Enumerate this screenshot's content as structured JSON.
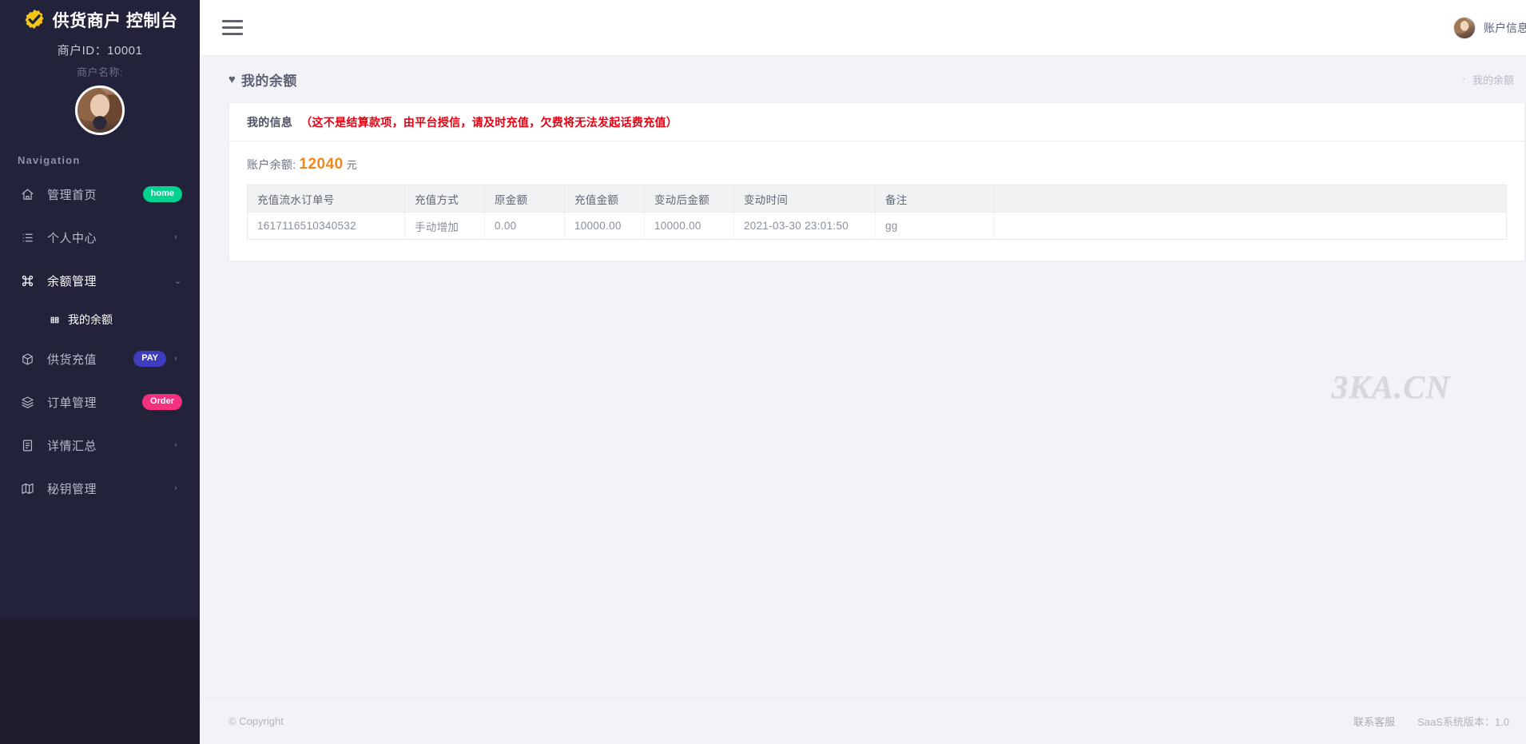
{
  "sidebar": {
    "brand_title": "供货商户 控制台",
    "brand_logo_icon": "gear-check-icon",
    "merchant_id": "商户ID：10001",
    "merchant_name": "商户名称:",
    "avatar_icon": "user-avatar",
    "nav_section_title": "Navigation",
    "items": [
      {
        "label": "管理首页",
        "icon": "home-icon",
        "badge": "home",
        "badge_color": "#00d28f",
        "arrow": "",
        "active": false
      },
      {
        "label": "个人中心",
        "icon": "list-icon",
        "badge": "",
        "badge_color": "",
        "arrow": "›",
        "active": false
      },
      {
        "label": "余额管理",
        "icon": "command-icon",
        "badge": "",
        "badge_color": "",
        "arrow": "⌄",
        "active": true
      },
      {
        "label": "供货充值",
        "icon": "box-icon",
        "badge": "PAY",
        "badge_color": "#4b4bd6",
        "arrow": "›",
        "active": false
      },
      {
        "label": "订单管理",
        "icon": "layers-icon",
        "badge": "Order",
        "badge_color": "#f5317f",
        "arrow": "",
        "active": false
      },
      {
        "label": "详情汇总",
        "icon": "file-icon",
        "badge": "",
        "badge_color": "",
        "arrow": "›",
        "active": false
      },
      {
        "label": "秘钥管理",
        "icon": "map-icon",
        "badge": "",
        "badge_color": "",
        "arrow": "›",
        "active": false
      }
    ],
    "sub_item": {
      "label": "我的余额",
      "icon": "balance-icon"
    }
  },
  "topbar": {
    "menu_toggle_icon": "hamburger-icon",
    "account_label": "账户信息",
    "account_avatar_icon": "user-avatar"
  },
  "page": {
    "title": "我的余额",
    "title_icon": "heart-icon",
    "breadcrumb_sep": "›",
    "breadcrumb_current": "我的余额"
  },
  "card": {
    "head_title": "我的信息",
    "head_warning": "（这不是结算款项，由平台授信，请及时充值，欠费将无法发起话费充值）",
    "warning_color": "#e60012",
    "balance_label": "账户余额:",
    "balance_amount": "12040",
    "balance_unit": "元",
    "balance_color": "#f0861e"
  },
  "table": {
    "columns": [
      "充值流水订单号",
      "充值方式",
      "原金额",
      "充值金额",
      "变动后金额",
      "变动时间",
      "备注",
      ""
    ],
    "rows": [
      {
        "order_no": "1617116510340532",
        "method": "手动增加",
        "original_amount": "0.00",
        "recharge_amount": "10000.00",
        "after_amount": "10000.00",
        "change_time": "2021-03-30 23:01:50",
        "remark": "gg",
        "extra": ""
      }
    ]
  },
  "watermark": {
    "text": "3KA.CN"
  },
  "footer": {
    "copyright": "© Copyright",
    "support_link": "联系客服",
    "version": "SaaS系统版本：1.0"
  }
}
